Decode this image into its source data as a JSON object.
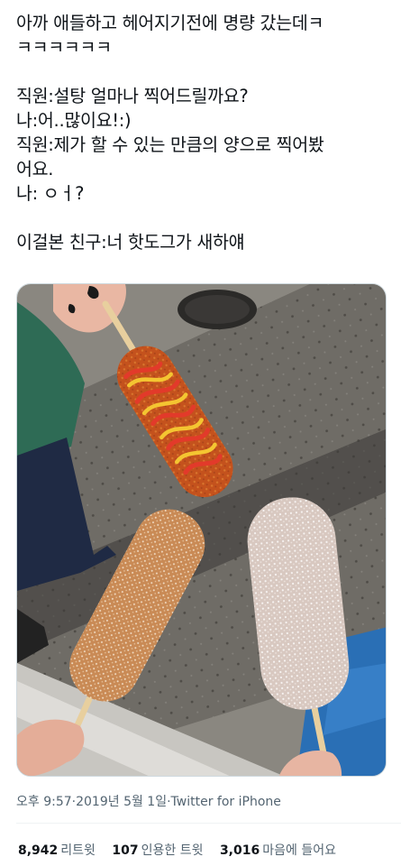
{
  "tweet": {
    "lines": [
      "아까 애들하고 헤어지기전에 명량 갔는데ㅋ",
      "ㅋㅋㅋㅋㅋㅋ",
      "",
      "직원:설탕 얼마나 찍어드릴까요?",
      "나:어..많이요!:)",
      "직원:제가 할 수 있는 만큼의 양으로 찍어봤",
      "어요.",
      "나: ㅇㅓ?",
      "",
      "이걸본 친구:너 핫도그가 새하얘"
    ]
  },
  "meta": {
    "time": "오후 9:57",
    "sep1": " · ",
    "date": "2019년 5월 1일",
    "sep2": " · ",
    "source": "Twitter for iPhone"
  },
  "stats": {
    "retweets": {
      "count": "8,942",
      "label": "리트윗"
    },
    "quotes": {
      "count": "107",
      "label": "인용한 트윗"
    },
    "likes": {
      "count": "3,016",
      "label": "마음에 들어요"
    }
  },
  "colors": {
    "text": "#0f1419",
    "secondary": "#536471",
    "border": "#eff3f4"
  }
}
